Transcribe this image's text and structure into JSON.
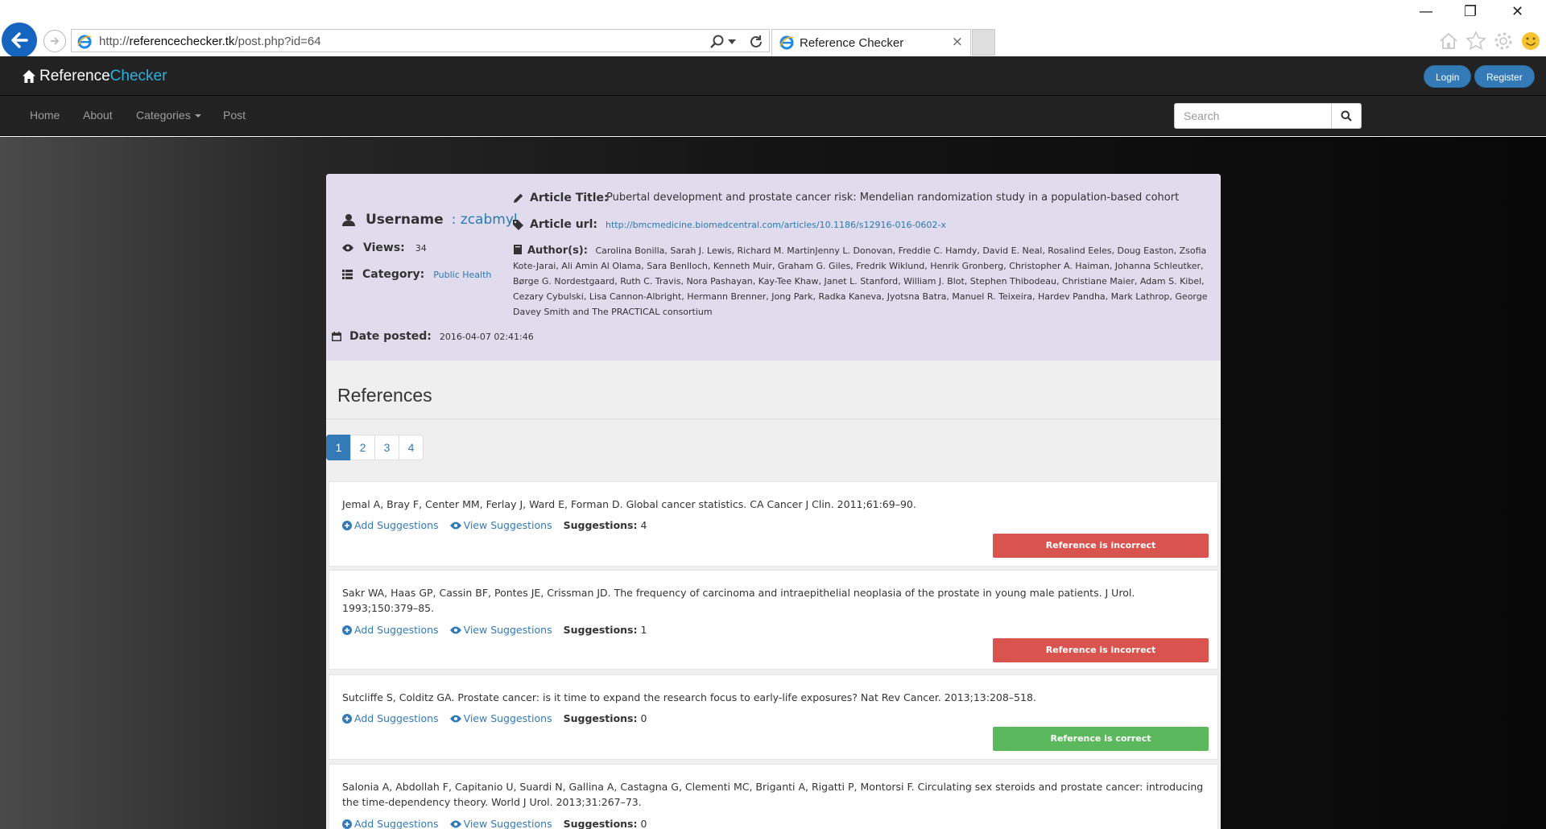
{
  "browser": {
    "url_prefix": "http://",
    "url_domain": "referencechecker.tk",
    "url_path": "/post.php?id=64",
    "tab_title": "Reference Checker",
    "tab_close": "×"
  },
  "window": {
    "minimize": "—",
    "restore": "❐",
    "close": "✕"
  },
  "site": {
    "brand_part1": "Reference",
    "brand_part2": "Checker",
    "login_label": "Login",
    "register_label": "Register",
    "accent_color": "#2fb0dc"
  },
  "nav": {
    "home": "Home",
    "about": "About",
    "categories": "Categories",
    "post": "Post",
    "search_placeholder": "Search"
  },
  "post": {
    "username_label": "Username",
    "username_value": ": zcabmyl",
    "views_label": "Views:",
    "views_value": "34",
    "category_label": "Category:",
    "category_value": "Public Health",
    "date_label": "Date posted:",
    "date_value": "2016-04-07 02:41:46",
    "title_label": "Article Title:",
    "title_value": "Pubertal development and prostate cancer risk: Mendelian randomization study in a population-based cohort",
    "url_label": "Article url:",
    "url_value": "http://bmcmedicine.biomedcentral.com/articles/10.1186/s12916-016-0602-x",
    "authors_label": "Author(s):",
    "authors_value": "Carolina Bonilla, Sarah J. Lewis, Richard M. MartinJenny L. Donovan, Freddie C. Hamdy, David E. Neal, Rosalind Eeles, Doug Easton, Zsofia Kote-Jarai, Ali Amin Al Olama, Sara Benlloch, Kenneth Muir, Graham G. Giles, Fredrik Wiklund, Henrik Gronberg, Christopher A. Haiman, Johanna Schleutker, Børge G. Nordestgaard, Ruth C. Travis, Nora Pashayan, Kay-Tee Khaw, Janet L. Stanford, William J. Blot, Stephen Thibodeau, Christiane Maier, Adam S. Kibel, Cezary Cybulski, Lisa Cannon-Albright, Hermann Brenner, Jong Park, Radka Kaneva, Jyotsna Batra, Manuel R. Teixeira, Hardev Pandha, Mark Lathrop, George Davey Smith and The PRACTICAL consortium"
  },
  "references": {
    "heading": "References",
    "pages": [
      "1",
      "2",
      "3",
      "4"
    ],
    "add_label": "Add Suggestions",
    "view_label": "View Suggestions",
    "suggestions_label": "Suggestions:",
    "items": [
      {
        "text": "Jemal A, Bray F, Center MM, Ferlay J, Ward E, Forman D. Global cancer statistics. CA Cancer J Clin. 2011;61:69–90.",
        "suggestions": "4",
        "status": "Reference is incorrect"
      },
      {
        "text": "Sakr WA, Haas GP, Cassin BF, Pontes JE, Crissman JD. The frequency of carcinoma and intraepithelial neoplasia of the prostate in young male patients. J Urol. 1993;150:379–85.",
        "suggestions": "1",
        "status": "Reference is incorrect"
      },
      {
        "text": "Sutcliffe S, Colditz GA. Prostate cancer: is it time to expand the research focus to early-life exposures? Nat Rev Cancer. 2013;13:208–518.",
        "suggestions": "0",
        "status": "Reference is correct"
      },
      {
        "text": "Salonia A, Abdollah F, Capitanio U, Suardi N, Gallina A, Castagna G, Clementi MC, Briganti A, Rigatti P, Montorsi F. Circulating sex steroids and prostate cancer: introducing the time-dependency theory. World J Urol. 2013;31:267–73.",
        "suggestions": "0"
      }
    ]
  }
}
